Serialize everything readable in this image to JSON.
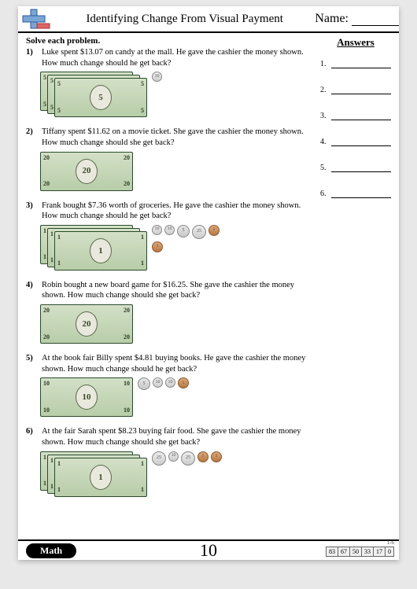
{
  "header": {
    "title": "Identifying Change From Visual Payment",
    "name_label": "Name:"
  },
  "instruction": "Solve each problem.",
  "answers_header": "Answers",
  "answers": [
    {
      "num": "1."
    },
    {
      "num": "2."
    },
    {
      "num": "3."
    },
    {
      "num": "4."
    },
    {
      "num": "5."
    },
    {
      "num": "6."
    }
  ],
  "problems": [
    {
      "num": "1)",
      "text": "Luke spent $13.07 on candy at the mall. He gave the cashier the money shown. How much change should he get back?",
      "bills": [
        {
          "denom": "5"
        },
        {
          "denom": "5"
        },
        {
          "denom": "5"
        }
      ],
      "bill_layout": "stack3",
      "coins": [
        "dime"
      ]
    },
    {
      "num": "2)",
      "text": "Tiffany spent $11.62 on a movie ticket. She gave the cashier the money shown. How much change should she get back?",
      "bills": [
        {
          "denom": "20"
        }
      ],
      "bill_layout": "single",
      "coins": []
    },
    {
      "num": "3)",
      "text": "Frank bought $7.36 worth of groceries. He gave the cashier the money shown. How much change should he get back?",
      "bills": [
        {
          "denom": "1"
        },
        {
          "denom": "1"
        },
        {
          "denom": "1"
        }
      ],
      "bill_layout": "stack3",
      "coins": [
        "dime",
        "dime",
        "nickel",
        "quarter",
        "penny",
        "penny"
      ]
    },
    {
      "num": "4)",
      "text": "Robin bought a new board game for $16.25. She gave the cashier the money shown. How much change should she get back?",
      "bills": [
        {
          "denom": "20"
        }
      ],
      "bill_layout": "single",
      "coins": []
    },
    {
      "num": "5)",
      "text": "At the book fair Billy spent $4.81 buying books. He gave the cashier the money shown. How much change should he get back?",
      "bills": [
        {
          "denom": "10"
        }
      ],
      "bill_layout": "single",
      "coins": [
        "nickel",
        "dime",
        "dime",
        "penny"
      ]
    },
    {
      "num": "6)",
      "text": "At the fair Sarah spent $8.23 buying fair food. She gave the cashier the money shown. How much change should she get back?",
      "bills": [
        {
          "denom": "1"
        },
        {
          "denom": "1"
        },
        {
          "denom": "1"
        }
      ],
      "bill_layout": "stack3",
      "coins": [
        "quarter",
        "dime",
        "quarter",
        "penny",
        "penny"
      ]
    }
  ],
  "footer": {
    "math_label": "Math",
    "page_number": "10",
    "range_label": "1-6",
    "scores": [
      "83",
      "67",
      "50",
      "33",
      "17",
      "0"
    ]
  },
  "chart_data": {
    "type": "table",
    "title": "Identifying Change From Visual Payment worksheet",
    "columns": [
      "problem",
      "amount_spent",
      "payment_bills",
      "payment_coins_cents"
    ],
    "rows": [
      {
        "problem": 1,
        "amount_spent": 13.07,
        "payment_bills": [
          5,
          5,
          5
        ],
        "payment_coins_cents": [
          10
        ]
      },
      {
        "problem": 2,
        "amount_spent": 11.62,
        "payment_bills": [
          20
        ],
        "payment_coins_cents": []
      },
      {
        "problem": 3,
        "amount_spent": 7.36,
        "payment_bills": [
          1,
          1,
          1
        ],
        "payment_coins_cents": [
          10,
          10,
          5,
          25,
          1,
          1
        ]
      },
      {
        "problem": 4,
        "amount_spent": 16.25,
        "payment_bills": [
          20
        ],
        "payment_coins_cents": []
      },
      {
        "problem": 5,
        "amount_spent": 4.81,
        "payment_bills": [
          10
        ],
        "payment_coins_cents": [
          5,
          10,
          10,
          1
        ]
      },
      {
        "problem": 6,
        "amount_spent": 8.23,
        "payment_bills": [
          1,
          1,
          1
        ],
        "payment_coins_cents": [
          25,
          10,
          25,
          1,
          1
        ]
      }
    ],
    "score_scale": {
      "range": "1-6",
      "percent_correct": [
        83,
        67,
        50,
        33,
        17,
        0
      ]
    }
  }
}
